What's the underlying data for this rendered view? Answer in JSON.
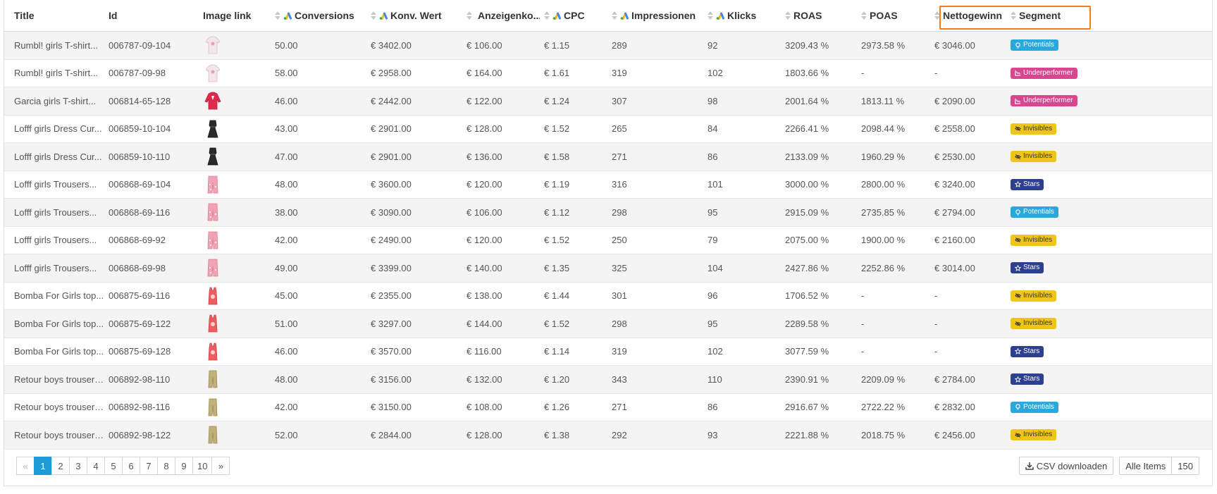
{
  "table": {
    "columns": [
      {
        "label": "Title",
        "sortable": false,
        "ads": false
      },
      {
        "label": "Id",
        "sortable": false,
        "ads": false
      },
      {
        "label": "Image link",
        "sortable": false,
        "ads": false
      },
      {
        "label": "Conversions",
        "sortable": true,
        "ads": true
      },
      {
        "label": "Konv. Wert",
        "sortable": true,
        "ads": true
      },
      {
        "label": "Anzeigenko...",
        "sortable": true,
        "ads": true
      },
      {
        "label": "CPC",
        "sortable": true,
        "ads": true
      },
      {
        "label": "Impressionen",
        "sortable": true,
        "ads": true
      },
      {
        "label": "Klicks",
        "sortable": true,
        "ads": true
      },
      {
        "label": "ROAS",
        "sortable": true,
        "ads": false
      },
      {
        "label": "POAS",
        "sortable": true,
        "ads": false
      },
      {
        "label": "Nettogewinn",
        "sortable": true,
        "ads": false
      },
      {
        "label": "Segment",
        "sortable": true,
        "ads": false
      }
    ],
    "rows": [
      {
        "title": "Rumbl! girls T-shirt...",
        "id": "006787-09-104",
        "img": "tshirt-white",
        "conv": "50.00",
        "wert": "€ 3402.00",
        "kosten": "€ 106.00",
        "cpc": "€ 1.15",
        "impr": "289",
        "klicks": "92",
        "roas": "3209.43 %",
        "poas": "2973.58 %",
        "netto": "€ 3046.00",
        "segment": "Potentials",
        "seg": "potentials"
      },
      {
        "title": "Rumbl! girls T-shirt...",
        "id": "006787-09-98",
        "img": "tshirt-white",
        "conv": "58.00",
        "wert": "€ 2958.00",
        "kosten": "€ 164.00",
        "cpc": "€ 1.61",
        "impr": "319",
        "klicks": "102",
        "roas": "1803.66 %",
        "poas": "-",
        "netto": "-",
        "segment": "Underperformer",
        "seg": "underperformer"
      },
      {
        "title": "Garcia girls T-shirt...",
        "id": "006814-65-128",
        "img": "shirt-red",
        "conv": "46.00",
        "wert": "€ 2442.00",
        "kosten": "€ 122.00",
        "cpc": "€ 1.24",
        "impr": "307",
        "klicks": "98",
        "roas": "2001.64 %",
        "poas": "1813.11 %",
        "netto": "€ 2090.00",
        "segment": "Underperformer",
        "seg": "underperformer"
      },
      {
        "title": "Lofff girls Dress Cur...",
        "id": "006859-10-104",
        "img": "dress-black",
        "conv": "43.00",
        "wert": "€ 2901.00",
        "kosten": "€ 128.00",
        "cpc": "€ 1.52",
        "impr": "265",
        "klicks": "84",
        "roas": "2266.41 %",
        "poas": "2098.44 %",
        "netto": "€ 2558.00",
        "segment": "Invisibles",
        "seg": "invisibles"
      },
      {
        "title": "Lofff girls Dress Cur...",
        "id": "006859-10-110",
        "img": "dress-black",
        "conv": "47.00",
        "wert": "€ 2901.00",
        "kosten": "€ 136.00",
        "cpc": "€ 1.58",
        "impr": "271",
        "klicks": "86",
        "roas": "2133.09 %",
        "poas": "1960.29 %",
        "netto": "€ 2530.00",
        "segment": "Invisibles",
        "seg": "invisibles"
      },
      {
        "title": "Lofff girls Trousers...",
        "id": "006868-69-104",
        "img": "trousers-pink",
        "conv": "48.00",
        "wert": "€ 3600.00",
        "kosten": "€ 120.00",
        "cpc": "€ 1.19",
        "impr": "316",
        "klicks": "101",
        "roas": "3000.00 %",
        "poas": "2800.00 %",
        "netto": "€ 3240.00",
        "segment": "Stars",
        "seg": "stars"
      },
      {
        "title": "Lofff girls Trousers...",
        "id": "006868-69-116",
        "img": "trousers-pink",
        "conv": "38.00",
        "wert": "€ 3090.00",
        "kosten": "€ 106.00",
        "cpc": "€ 1.12",
        "impr": "298",
        "klicks": "95",
        "roas": "2915.09 %",
        "poas": "2735.85 %",
        "netto": "€ 2794.00",
        "segment": "Potentials",
        "seg": "potentials"
      },
      {
        "title": "Lofff girls Trousers...",
        "id": "006868-69-92",
        "img": "trousers-pink",
        "conv": "42.00",
        "wert": "€ 2490.00",
        "kosten": "€ 120.00",
        "cpc": "€ 1.52",
        "impr": "250",
        "klicks": "79",
        "roas": "2075.00 %",
        "poas": "1900.00 %",
        "netto": "€ 2160.00",
        "segment": "Invisibles",
        "seg": "invisibles"
      },
      {
        "title": "Lofff girls Trousers...",
        "id": "006868-69-98",
        "img": "trousers-pink",
        "conv": "49.00",
        "wert": "€ 3399.00",
        "kosten": "€ 140.00",
        "cpc": "€ 1.35",
        "impr": "325",
        "klicks": "104",
        "roas": "2427.86 %",
        "poas": "2252.86 %",
        "netto": "€ 3014.00",
        "segment": "Stars",
        "seg": "stars"
      },
      {
        "title": "Bomba For Girls top...",
        "id": "006875-69-116",
        "img": "top-red",
        "conv": "45.00",
        "wert": "€ 2355.00",
        "kosten": "€ 138.00",
        "cpc": "€ 1.44",
        "impr": "301",
        "klicks": "96",
        "roas": "1706.52 %",
        "poas": "-",
        "netto": "-",
        "segment": "Invisibles",
        "seg": "invisibles"
      },
      {
        "title": "Bomba For Girls top...",
        "id": "006875-69-122",
        "img": "top-red",
        "conv": "51.00",
        "wert": "€ 3297.00",
        "kosten": "€ 144.00",
        "cpc": "€ 1.52",
        "impr": "298",
        "klicks": "95",
        "roas": "2289.58 %",
        "poas": "-",
        "netto": "-",
        "segment": "Invisibles",
        "seg": "invisibles"
      },
      {
        "title": "Bomba For Girls top...",
        "id": "006875-69-128",
        "img": "top-red",
        "conv": "46.00",
        "wert": "€ 3570.00",
        "kosten": "€ 116.00",
        "cpc": "€ 1.14",
        "impr": "319",
        "klicks": "102",
        "roas": "3077.59 %",
        "poas": "-",
        "netto": "-",
        "segment": "Stars",
        "seg": "stars"
      },
      {
        "title": "Retour boys trousers...",
        "id": "006892-98-110",
        "img": "trousers-khaki",
        "conv": "48.00",
        "wert": "€ 3156.00",
        "kosten": "€ 132.00",
        "cpc": "€ 1.20",
        "impr": "343",
        "klicks": "110",
        "roas": "2390.91 %",
        "poas": "2209.09 %",
        "netto": "€ 2784.00",
        "segment": "Stars",
        "seg": "stars"
      },
      {
        "title": "Retour boys trousers...",
        "id": "006892-98-116",
        "img": "trousers-khaki",
        "conv": "42.00",
        "wert": "€ 3150.00",
        "kosten": "€ 108.00",
        "cpc": "€ 1.26",
        "impr": "271",
        "klicks": "86",
        "roas": "2916.67 %",
        "poas": "2722.22 %",
        "netto": "€ 2832.00",
        "segment": "Potentials",
        "seg": "potentials"
      },
      {
        "title": "Retour boys trousers...",
        "id": "006892-98-122",
        "img": "trousers-khaki",
        "conv": "52.00",
        "wert": "€ 2844.00",
        "kosten": "€ 128.00",
        "cpc": "€ 1.38",
        "impr": "292",
        "klicks": "93",
        "roas": "2221.88 %",
        "poas": "2018.75 %",
        "netto": "€ 2456.00",
        "segment": "Invisibles",
        "seg": "invisibles"
      }
    ]
  },
  "segment_icons": {
    "potentials": "bulb-icon",
    "underperformer": "chart-down-icon",
    "invisibles": "eye-icon",
    "stars": "star-icon"
  },
  "pagination": {
    "prev": "«",
    "next": "»",
    "pages": [
      "1",
      "2",
      "3",
      "4",
      "5",
      "6",
      "7",
      "8",
      "9",
      "10"
    ],
    "active": "1"
  },
  "footer": {
    "csv_label": "CSV downloaden",
    "items_label": "Alle Items",
    "items_count": "150"
  },
  "colors": {
    "accent": "#1e9bd7",
    "highlight": "#ef7d22",
    "potentials": "#2aa7dd",
    "underperformer": "#d9458f",
    "invisibles": "#f0c419",
    "stars": "#2d3f8f"
  }
}
